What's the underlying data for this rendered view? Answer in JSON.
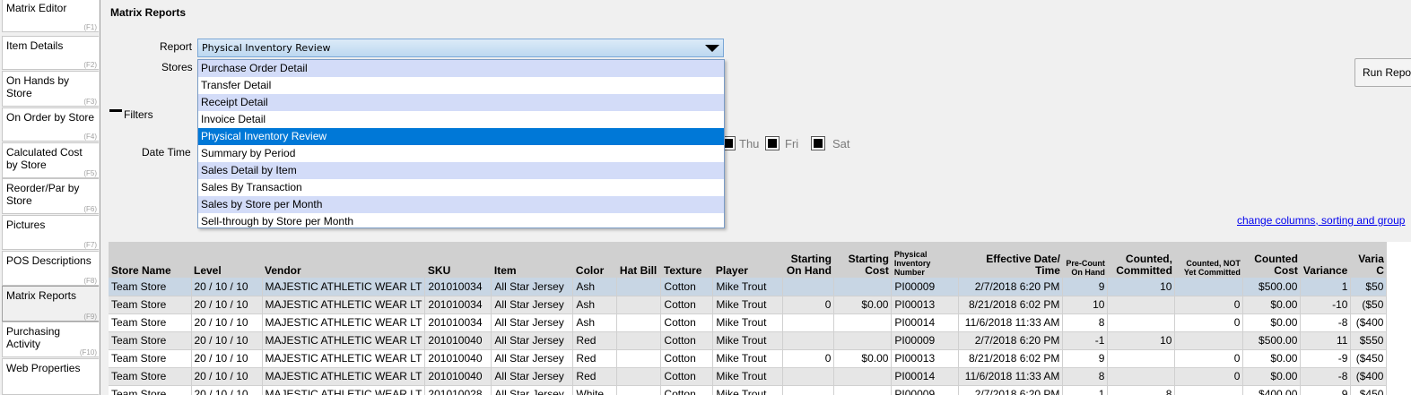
{
  "sidebar": {
    "items": [
      {
        "label": "Matrix Editor",
        "fkey": "(F1)"
      },
      {
        "label": "Item Details",
        "fkey": "(F2)"
      },
      {
        "label": "On Hands by Store",
        "fkey": "(F3)"
      },
      {
        "label": "On Order by Store",
        "fkey": "(F4)"
      },
      {
        "label": "Calculated Cost by Store",
        "fkey": "(F5)"
      },
      {
        "label": "Reorder/Par by Store",
        "fkey": "(F6)"
      },
      {
        "label": "Pictures",
        "fkey": "(F7)"
      },
      {
        "label": "POS Descriptions",
        "fkey": "(F8)"
      },
      {
        "label": "Matrix Reports",
        "fkey": "(F9)"
      },
      {
        "label": "Purchasing Activity",
        "fkey": "(F10)"
      },
      {
        "label": "Web Properties",
        "fkey": ""
      }
    ]
  },
  "page_title": "Matrix Reports",
  "form": {
    "report_label": "Report",
    "report_value": "Physical Inventory Review",
    "stores_label": "Stores",
    "filters_label": "Filters",
    "datetime_label": "Date Time",
    "days": [
      "Thu",
      "Fri",
      "Sat"
    ]
  },
  "dropdown": {
    "options": [
      "Purchase Order Detail",
      "Transfer Detail",
      "Receipt Detail",
      "Invoice Detail",
      "Physical Inventory Review",
      "Summary by Period",
      "Sales Detail by Item",
      "Sales By Transaction",
      "Sales by Store per Month",
      "Sell-through by Store per Month"
    ],
    "selected_index": 4
  },
  "run_report_label": "Run Repo",
  "change_link": "change columns, sorting and group",
  "grid": {
    "headers": [
      "Store Name",
      "Level",
      "Vendor",
      "SKU",
      "Item",
      "Color",
      "Hat Bill",
      "Texture",
      "Player",
      "Starting On Hand",
      "Starting Cost",
      "Physical Inventory Number",
      "Effective Date/ Time",
      "Pre-Count On Hand",
      "Counted, Committed",
      "Counted, NOT Yet Committed",
      "Counted Cost",
      "Variance",
      "Varia C"
    ],
    "rows": [
      [
        "Team Store",
        "20 / 10 / 10",
        "MAJESTIC ATHLETIC WEAR LT",
        "201010034",
        "All Star Jersey",
        "Ash",
        "",
        "Cotton",
        "Mike Trout",
        "",
        "",
        "PI00009",
        "2/7/2018 6:20 PM",
        "9",
        "10",
        "",
        "$500.00",
        "1",
        "$50"
      ],
      [
        "Team Store",
        "20 / 10 / 10",
        "MAJESTIC ATHLETIC WEAR LT",
        "201010034",
        "All Star Jersey",
        "Ash",
        "",
        "Cotton",
        "Mike Trout",
        "0",
        "$0.00",
        "PI00013",
        "8/21/2018 6:02 PM",
        "10",
        "",
        "0",
        "$0.00",
        "-10",
        "($50"
      ],
      [
        "Team Store",
        "20 / 10 / 10",
        "MAJESTIC ATHLETIC WEAR LT",
        "201010034",
        "All Star Jersey",
        "Ash",
        "",
        "Cotton",
        "Mike Trout",
        "",
        "",
        "PI00014",
        "11/6/2018 11:33 AM",
        "8",
        "",
        "0",
        "$0.00",
        "-8",
        "($400"
      ],
      [
        "Team Store",
        "20 / 10 / 10",
        "MAJESTIC ATHLETIC WEAR LT",
        "201010040",
        "All Star Jersey",
        "Red",
        "",
        "Cotton",
        "Mike Trout",
        "",
        "",
        "PI00009",
        "2/7/2018 6:20 PM",
        "-1",
        "10",
        "",
        "$500.00",
        "11",
        "$550"
      ],
      [
        "Team Store",
        "20 / 10 / 10",
        "MAJESTIC ATHLETIC WEAR LT",
        "201010040",
        "All Star Jersey",
        "Red",
        "",
        "Cotton",
        "Mike Trout",
        "0",
        "$0.00",
        "PI00013",
        "8/21/2018 6:02 PM",
        "9",
        "",
        "0",
        "$0.00",
        "-9",
        "($450"
      ],
      [
        "Team Store",
        "20 / 10 / 10",
        "MAJESTIC ATHLETIC WEAR LT",
        "201010040",
        "All Star Jersey",
        "Red",
        "",
        "Cotton",
        "Mike Trout",
        "",
        "",
        "PI00014",
        "11/6/2018 11:33 AM",
        "8",
        "",
        "0",
        "$0.00",
        "-8",
        "($400"
      ],
      [
        "Team Store",
        "20 / 10 / 10",
        "MAJESTIC ATHLETIC WEAR LT",
        "201010028",
        "All Star Jersey",
        "White",
        "",
        "Cotton",
        "Mike Trout",
        "",
        "",
        "PI00009",
        "2/7/2018 6:20 PM",
        "1",
        "8",
        "",
        "$400.00",
        "9",
        "$450"
      ]
    ]
  }
}
